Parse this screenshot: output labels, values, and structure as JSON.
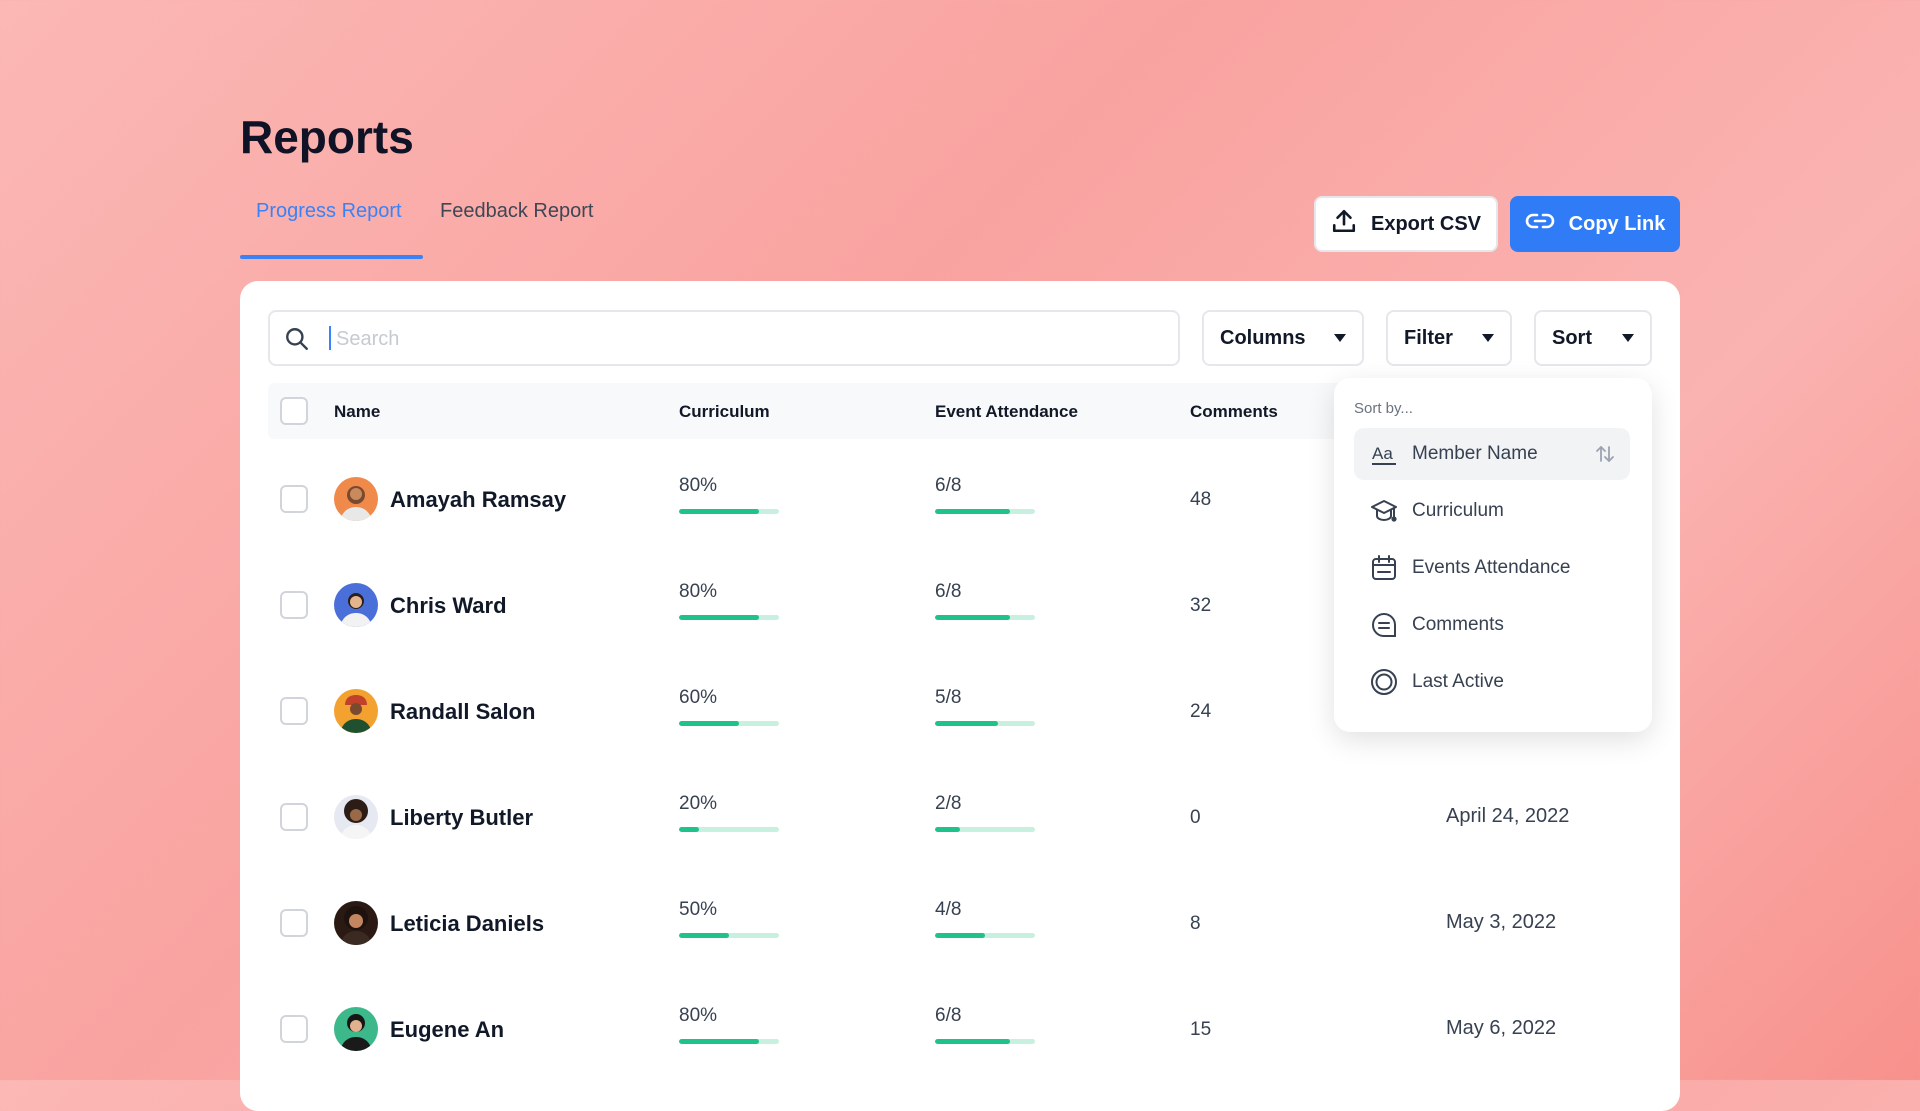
{
  "page": {
    "title": "Reports"
  },
  "tabs": [
    {
      "label": "Progress Report",
      "active": true
    },
    {
      "label": "Feedback Report",
      "active": false
    }
  ],
  "actions": {
    "export_label": "Export CSV",
    "copy_label": "Copy Link"
  },
  "toolbar": {
    "search_placeholder": "Search",
    "search_value": "",
    "columns_label": "Columns",
    "filter_label": "Filter",
    "sort_label": "Sort"
  },
  "table": {
    "headers": {
      "name": "Name",
      "curriculum": "Curriculum",
      "attendance": "Event Attendance",
      "comments": "Comments"
    },
    "rows": [
      {
        "name": "Amayah Ramsay",
        "curriculum": "80%",
        "curriculum_progress": 0.8,
        "attendance": "6/8",
        "attendance_progress": 0.75,
        "comments": "48",
        "last_active": ""
      },
      {
        "name": "Chris Ward",
        "curriculum": "80%",
        "curriculum_progress": 0.8,
        "attendance": "6/8",
        "attendance_progress": 0.75,
        "comments": "32",
        "last_active": ""
      },
      {
        "name": "Randall Salon",
        "curriculum": "60%",
        "curriculum_progress": 0.6,
        "attendance": "5/8",
        "attendance_progress": 0.625,
        "comments": "24",
        "last_active": ""
      },
      {
        "name": "Liberty Butler",
        "curriculum": "20%",
        "curriculum_progress": 0.2,
        "attendance": "2/8",
        "attendance_progress": 0.25,
        "comments": "0",
        "last_active": "April 24, 2022"
      },
      {
        "name": "Leticia Daniels",
        "curriculum": "50%",
        "curriculum_progress": 0.5,
        "attendance": "4/8",
        "attendance_progress": 0.5,
        "comments": "8",
        "last_active": "May 3, 2022"
      },
      {
        "name": "Eugene An",
        "curriculum": "80%",
        "curriculum_progress": 0.8,
        "attendance": "6/8",
        "attendance_progress": 0.75,
        "comments": "15",
        "last_active": "May 6, 2022"
      }
    ]
  },
  "sort_menu": {
    "heading": "Sort by...",
    "items": [
      {
        "label": "Member Name",
        "icon": "text-aa-icon",
        "selected": true
      },
      {
        "label": "Curriculum",
        "icon": "graduation-cap-icon",
        "selected": false
      },
      {
        "label": "Events Attendance",
        "icon": "calendar-icon",
        "selected": false
      },
      {
        "label": "Comments",
        "icon": "comment-icon",
        "selected": false
      },
      {
        "label": "Last Active",
        "icon": "target-icon",
        "selected": false
      }
    ]
  },
  "colors": {
    "accent": "#2f7cf6",
    "progress": "#1fc28a",
    "progress_track": "#c8f0df"
  }
}
